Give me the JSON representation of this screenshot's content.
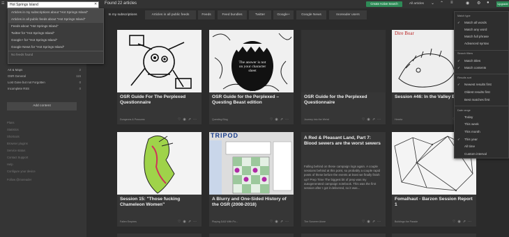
{
  "search": {
    "value": "Hot Springs Island",
    "suggestions": [
      "Articles in my subscriptions about \"Hot Springs Island\"",
      "Articles in all public feeds about \"Hot Springs Island\"",
      "Feeds about \"Hot Springs Island\"",
      "Twitter for \"Hot Springs Island\"",
      "Google+ for \"Hot Springs Island\"",
      "Google News for \"Hot Springs Island\"",
      "No feeds found"
    ]
  },
  "sidebar": {
    "feeds": [
      {
        "label": "Art & Maps",
        "count": "2"
      },
      {
        "label": "OSR General",
        "count": "115"
      },
      {
        "label": "Lost Gone but not Forgotten",
        "count": "0"
      },
      {
        "label": "Incomplete RSS",
        "count": "0"
      }
    ],
    "add_content": "Add content",
    "links": [
      "Plans",
      "Statistics",
      "Shortcuts",
      "Browser plugins",
      "Service status",
      "Contact Support",
      "Help",
      "Configure your device",
      "Follow @inoreader"
    ]
  },
  "header": {
    "found": "Found 22 articles",
    "active_search": "Create Active Search",
    "all_articles": "All articles",
    "upgrade": "Upgrade"
  },
  "tabs": [
    "In my subscriptions",
    "Articles in all public feeds",
    "Feeds",
    "Feed bundles",
    "Twitter",
    "Google+",
    "Google News",
    "Inoreader users"
  ],
  "cards": [
    {
      "title": "OSR Guide For The Perplexed Questionnaire",
      "source": "Dungeons & Possums"
    },
    {
      "title": "OSR Guide for the Perplexed – Questing Beast edition",
      "source": "Questing Blog",
      "quote": "The answer is not on your character sheet"
    },
    {
      "title": "OSR Guide for the Perplexed Questionnaire",
      "source": "Journey into the Weird"
    },
    {
      "title": "Session #46: In the Valley Beasts",
      "source": "Hexeta",
      "image_text": "Dire Boar"
    },
    {
      "title": "Session 15: \"Those fucking Chameleon Women\"",
      "source": "Fallen Empires"
    },
    {
      "title": "A Blurry and One-Sided History of the OSR (2008-2018)",
      "source": "Playing D&D With Po...",
      "image_text": "TRIPOD"
    },
    {
      "title": "A Red & Pleasant Land, Part 7: Blood sewers are the worst sewers",
      "source": "The Sorcerer Alone",
      "summary": "Falling behind on these campaign logs again. A couple sessions behind at this point, so probably a couple rapid posts of these before the events at least we finally finish up? Prep Time The biggest bit of prep was my autogenerated campaign notebook. This was the first session after I got it delivered, so it was..."
    },
    {
      "title": "Fomalhaut - Barzon Session Report 1",
      "source": "Buildings the Parade"
    }
  ],
  "menu": {
    "match_type": "Match type",
    "match_items": [
      "Match all words",
      "Match any word",
      "Match full phrase",
      "Advanced syntax"
    ],
    "search_filters": "Search filters",
    "filter_items": [
      "Match titles",
      "Match contents"
    ],
    "results_sort": "Results sort",
    "sort_items": [
      "Newest results first",
      "Oldest results first",
      "Best matches first"
    ],
    "date_range": "Date range",
    "date_items": [
      "Today",
      "This week",
      "This month",
      "This year",
      "All time",
      "Custom interval"
    ]
  },
  "colors": {
    "accent": "#2e8b57",
    "background": "#2b2b2b",
    "sidebar": "#353535"
  }
}
